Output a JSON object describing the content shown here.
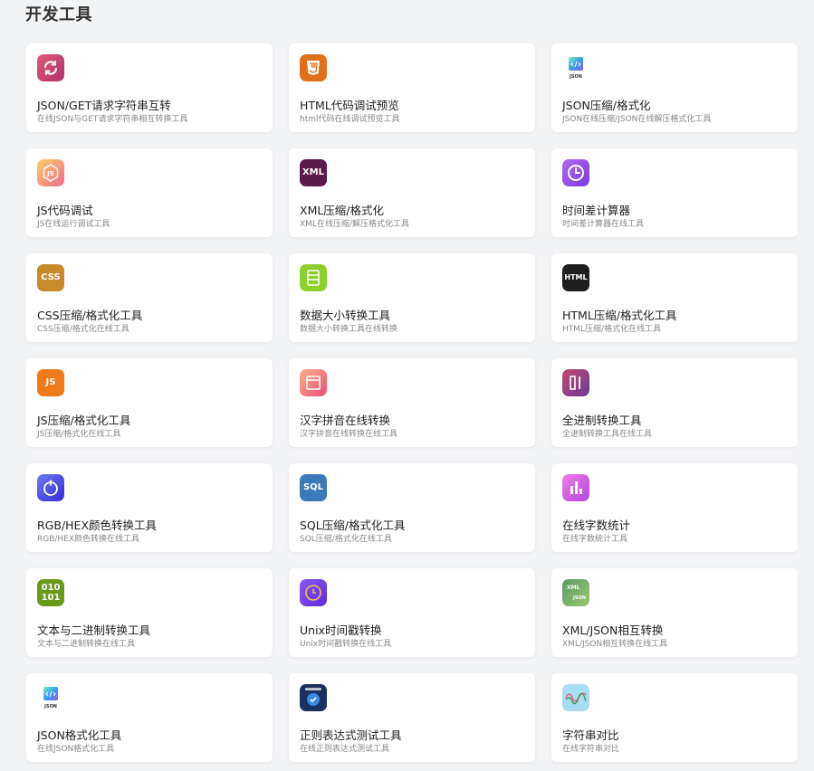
{
  "section": {
    "title": "开发工具"
  },
  "tools": [
    {
      "title": "JSON/GET请求字符串互转",
      "desc": "在线JSON与GET请求字符串相互转换工具",
      "icon": "refresh-icon",
      "color": "#c8406a"
    },
    {
      "title": "HTML代码调试预览",
      "desc": "html代码在线调试预览工具",
      "icon": "html5-icon",
      "color": "#e0701a"
    },
    {
      "title": "JSON压缩/格式化",
      "desc": "JSON在线压缩/JSON在线解压格式化工具",
      "icon": "json-doc-icon",
      "color": "#3aa0e8"
    },
    {
      "title": "JS代码调试",
      "desc": "JS在线运行调试工具",
      "icon": "js-hexagon-icon",
      "color": "#f7a25b"
    },
    {
      "title": "XML压缩/格式化",
      "desc": "XML在线压缩/解压格式化工具",
      "icon": "xml-icon",
      "color": "#5a1a4a",
      "label": "XML"
    },
    {
      "title": "时间差计算器",
      "desc": "时间差计算器在线工具",
      "icon": "clock-icon",
      "color": "#8a4de8"
    },
    {
      "title": "CSS压缩/格式化工具",
      "desc": "CSS压缩/格式化在线工具",
      "icon": "css-icon",
      "color": "#c98a2a",
      "label": "CSS"
    },
    {
      "title": "数据大小转换工具",
      "desc": "数据大小转换工具在线转换",
      "icon": "storage-icon",
      "color": "#8ecf2e"
    },
    {
      "title": "HTML压缩/格式化工具",
      "desc": "HTML压缩/格式化在线工具",
      "icon": "html-text-icon",
      "color": "#1e1e1e",
      "label": "HTML"
    },
    {
      "title": "JS压缩/格式化工具",
      "desc": "JS压缩/格式化在线工具",
      "icon": "js-icon",
      "color": "#f07a1a",
      "label": "JS"
    },
    {
      "title": "汉字拼音在线转换",
      "desc": "汉字拼音在线转换在线工具",
      "icon": "pinyin-icon",
      "color": "#f06a6a"
    },
    {
      "title": "全进制转换工具",
      "desc": "全进制转换工具在线工具",
      "icon": "binary-base-icon",
      "color": "#a83a5a"
    },
    {
      "title": "RGB/HEX颜色转换工具",
      "desc": "RGB/HEX颜色转换在线工具",
      "icon": "color-drop-icon",
      "color": "#4a4ae8"
    },
    {
      "title": "SQL压缩/格式化工具",
      "desc": "SQL压缩/格式化在线工具",
      "icon": "sql-icon",
      "color": "#3a7ab8",
      "label": "SQL"
    },
    {
      "title": "在线字数统计",
      "desc": "在线字数统计工具",
      "icon": "bar-chart-icon",
      "color": "#d85ae0"
    },
    {
      "title": "文本与二进制转换工具",
      "desc": "文本与二进制转换在线工具",
      "icon": "binary-icon",
      "color": "#6a9a1a",
      "label": "010\n101"
    },
    {
      "title": "Unix时间戳转换",
      "desc": "Unix时间戳转换在线工具",
      "icon": "timestamp-icon",
      "color": "#6a3ae8"
    },
    {
      "title": "XML/JSON相互转换",
      "desc": "XML/JSON相互转换在线工具",
      "icon": "xml-json-icon",
      "color": "#6aa86a"
    },
    {
      "title": "JSON格式化工具",
      "desc": "在线JSON格式化工具",
      "icon": "json-doc-icon",
      "color": "#3aa0e8"
    },
    {
      "title": "正则表达式测试工具",
      "desc": "在线正则表达式测试工具",
      "icon": "regex-shield-icon",
      "color": "#1a3a6a"
    },
    {
      "title": "字符串对比",
      "desc": "在线字符串对比",
      "icon": "diff-wave-icon",
      "color": "#7ac8e8"
    }
  ]
}
